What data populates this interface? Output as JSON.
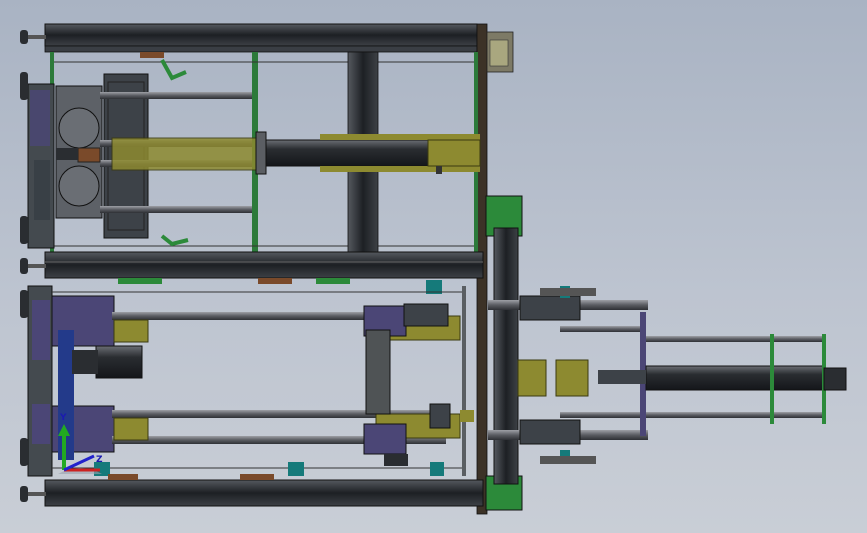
{
  "viewport": {
    "background_top": "#a9b3c3",
    "background_bottom": "#c9ced6"
  },
  "model": {
    "frame_color": "#2a2f36",
    "rod_color": "#7a7c82",
    "olive_color": "#8d8a30",
    "green_color": "#2c8a3a",
    "purple_color": "#4b4676",
    "teal_color": "#157a7a",
    "brown_color": "#7a4a2a"
  },
  "triad": {
    "y_axis_label": "Y",
    "z_axis_label": "Z",
    "y_axis_color": "#22aa22",
    "x_axis_color": "#cc2222",
    "z_axis_color": "#2222cc"
  }
}
